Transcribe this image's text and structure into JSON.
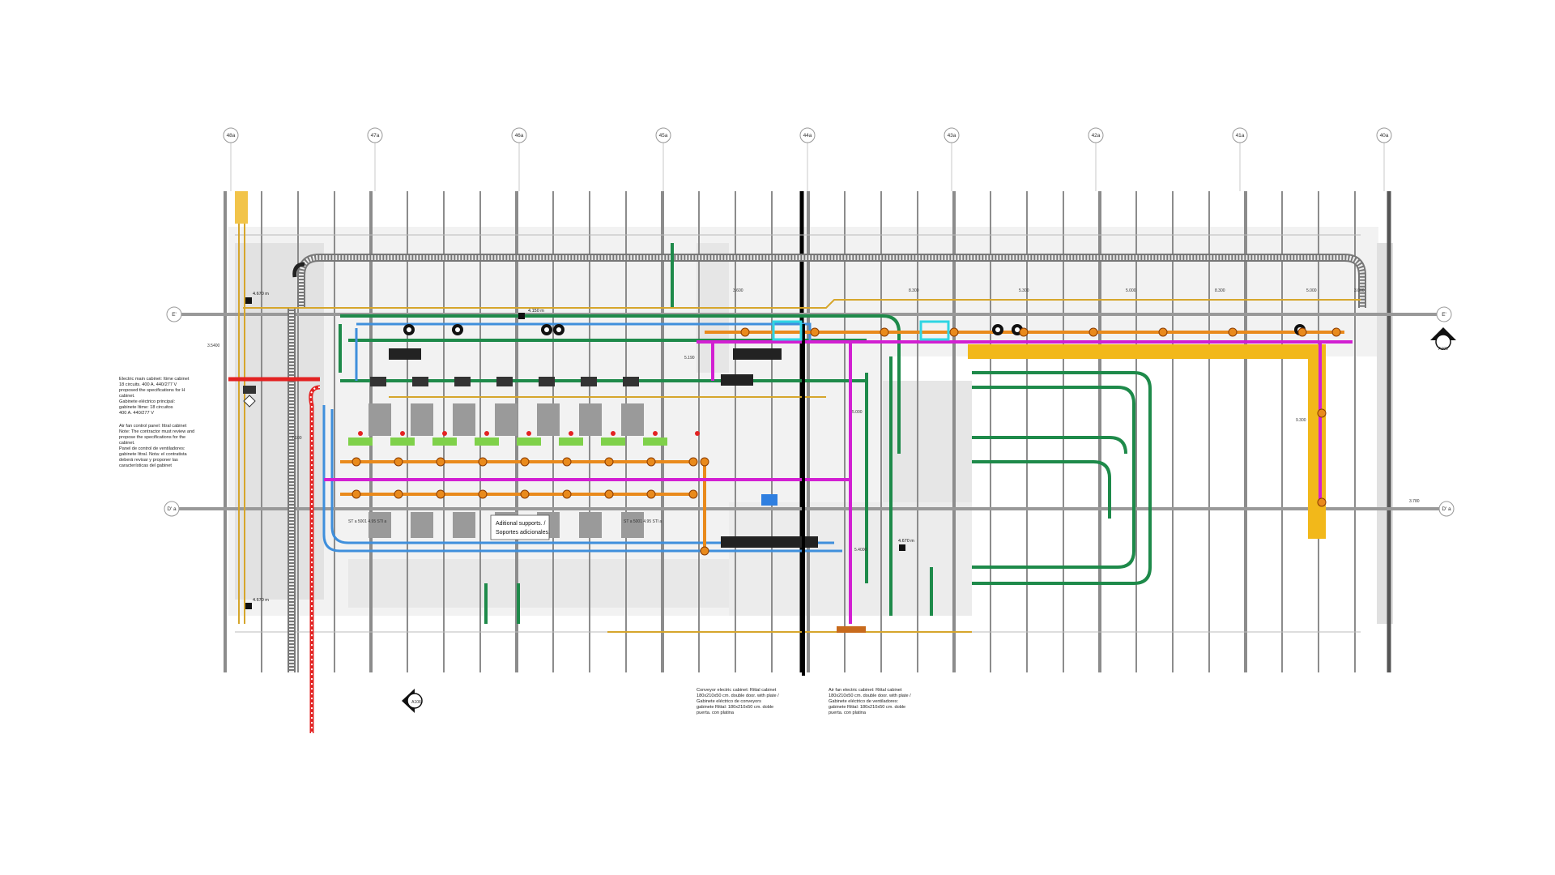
{
  "grid": {
    "columns": [
      "48a",
      "47a",
      "46a",
      "45a",
      "44a",
      "43a",
      "42a",
      "41a",
      "40a"
    ],
    "rows": [
      "E'",
      "D'  a"
    ]
  },
  "levels": [
    "4.670 m",
    "4.670 m",
    "4.670 m",
    "4.150 m"
  ],
  "dimensions": [
    "3.5400",
    "7.100",
    "5.190",
    "5.000",
    "8.300",
    "3.600",
    "5.000",
    "8.300",
    "5.300",
    "5.000",
    "3.000",
    "9.300",
    "5.4000",
    "3.780"
  ],
  "section_marks": [
    "A108",
    "A108"
  ],
  "support_labels": {
    "en": "Aditional supports. /",
    "es": "Soportes adicionales."
  },
  "cabinet_tags": [
    "ST a 5001\n4.95 STl a",
    "ST a 5001\n4.95 STl a"
  ],
  "notes": {
    "electric_main": "Electric main cabinet: Itime cabinet\n18 circuits. 400 A. 440/277 V\nproposed the specifications for H\ncabinet.\nGabinete eléctrico principal:\ngabinete Itime: 18 circuitos\n400 A. 440/277 V",
    "air_fan_control": "Air fan control panel: Ittral cabinet\nNote: The contractor must review and\npropose the specifications for the\ncabinet.\nPanel de control de ventiladores:\ngabinete Ittral. Nota: el contratista\ndeberá revisar y proponer las\ncaracterísticas del gabinet",
    "conveyor_cabinet": "Conveyor electric cabinet: Rittal cabinet\n180x210x50 cm. double door. with plate /\nGabinete eléctrico de conveyors\ngabinete Rittal: 180x210x50 cm. doble\npuerta. con platina",
    "air_fan_cabinet": "Air fan electric cabinet: Rittal cabinet\n180x210x50 cm. double door. with plate /\nGabinete eléctrico de ventiladores:\ngabinete Rittal: 180x210x50 cm. doble\npuerta. con platina"
  },
  "colors": {
    "cable_tray_red": "#e32222",
    "cable_tray_green": "#1e8a4a",
    "cable_tray_orange": "#e98a1c",
    "cable_tray_magenta": "#d21fd2",
    "cable_tray_blue": "#3f8fdc",
    "cable_tray_yellow": "#f2b81a",
    "conduit_gold": "#d6a62c",
    "cabinet_cyan": "#2fd5e3"
  }
}
